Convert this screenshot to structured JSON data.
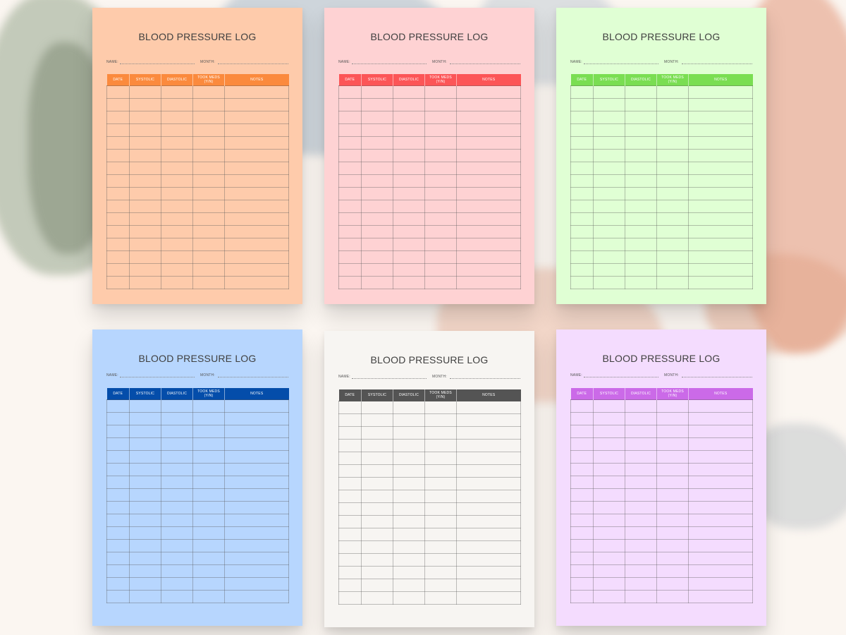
{
  "title": "BLOOD PRESSURE LOG",
  "name_label": "NAME:",
  "month_label": "MONTH:",
  "columns": [
    "DATE",
    "SYSTOLIC",
    "DIASTOLIC",
    "TOOK MEDS (Y/N)",
    "NOTES"
  ],
  "row_count": 16,
  "sheets": [
    {
      "id": "orange",
      "page_color": "#fecbab",
      "header_color": "#fb8a3d"
    },
    {
      "id": "pink",
      "page_color": "#fed2d3",
      "header_color": "#fc5557"
    },
    {
      "id": "green",
      "page_color": "#e0ffd4",
      "header_color": "#7ade52"
    },
    {
      "id": "blue",
      "page_color": "#b7d6fe",
      "header_color": "#044daa"
    },
    {
      "id": "grey",
      "page_color": "#f7f5f2",
      "header_color": "#545454"
    },
    {
      "id": "purple",
      "page_color": "#f4dcfe",
      "header_color": "#cb6ae8"
    }
  ]
}
